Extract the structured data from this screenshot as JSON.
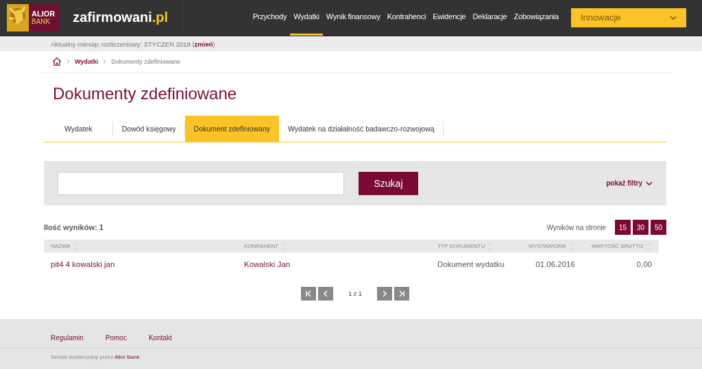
{
  "header": {
    "logo": {
      "line1": "ALIOR",
      "line2": "BANK"
    },
    "site": {
      "name": "zafirmowani",
      "suffix": ".pl"
    },
    "nav": [
      {
        "label": "Przychody",
        "selected": false
      },
      {
        "label": "Wydatki",
        "selected": true
      },
      {
        "label": "Wynik finansowy",
        "selected": false
      },
      {
        "label": "Kontrahenci",
        "selected": false
      },
      {
        "label": "Ewidencje",
        "selected": false
      },
      {
        "label": "Deklaracje",
        "selected": false
      },
      {
        "label": "Zobowiązania",
        "selected": false
      }
    ],
    "dropdown": {
      "value": "Innowacje"
    }
  },
  "period_bar": {
    "text": "Aktualny miesiąc rozliczeniowy: STYCZEŃ 2018 (",
    "link": "zmień",
    "after": ")"
  },
  "breadcrumb": [
    {
      "label": "Wydatki"
    },
    {
      "label": "Dokumenty zdefiniowane"
    }
  ],
  "title": "Dokumenty zdefiniowane",
  "tabs": [
    {
      "label": "Wydatek",
      "selected": false
    },
    {
      "label": "Dowód księgowy",
      "selected": false
    },
    {
      "label": "Dokument zdefiniowany",
      "selected": true
    },
    {
      "label": "Wydatek na działalność badawczo-rozwojową",
      "selected": false
    }
  ],
  "search": {
    "button": "Szukaj",
    "filters": "pokaż filtry"
  },
  "results": {
    "count": "Ilość wyników: 1",
    "per_page_label": "Wyników na stronie",
    "per_page": [
      "15",
      "30",
      "50"
    ]
  },
  "table": {
    "columns": [
      {
        "label": "NAZWA",
        "kind": "link"
      },
      {
        "label": "KONRAHENT",
        "kind": "link"
      },
      {
        "label": "TYP DOKUMENTU",
        "kind": "text"
      },
      {
        "label": "WYSTAWIONA",
        "kind": "number"
      },
      {
        "label": "WARTOŚĆ BRUTTO",
        "kind": "number"
      }
    ],
    "rows": [
      {
        "cells": [
          "pit4 4 kowalski jan",
          "Kowalski Jan",
          "Dokument wydatku",
          "01.06.2016",
          "0,00"
        ]
      }
    ]
  },
  "pagination": {
    "label": "1 z 1"
  },
  "footer": {
    "links": [
      "Regulamin",
      "Pomoc",
      "Kontakt"
    ],
    "text": "Serwis dostarczany przez ",
    "link": "Alior Bank",
    "after": "."
  }
}
